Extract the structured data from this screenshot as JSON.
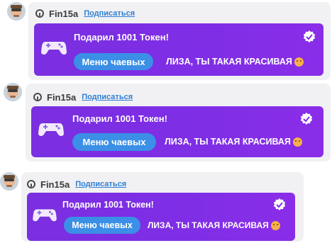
{
  "messages": [
    {
      "username": "Fin15a",
      "subscribe_label": "Подписаться",
      "title": "Подарил 1001 Токен!",
      "tip_button": "Меню чаевых",
      "text": "ЛИЗА, ТЫ ТАКАЯ КРАСИВАЯ"
    },
    {
      "username": "Fin15a",
      "subscribe_label": "Подписаться",
      "title": "Подарил 1001 Токен!",
      "tip_button": "Меню чаевых",
      "text": "ЛИЗА, ТЫ ТАКАЯ КРАСИВАЯ"
    },
    {
      "username": "Fin15a",
      "subscribe_label": "Подписаться",
      "title": "Подарил 1001 Токен!",
      "tip_button": "Меню чаевых",
      "text": "ЛИЗА, ТЫ ТАКАЯ КРАСИВАЯ"
    }
  ],
  "colors": {
    "card_gradient_start": "#7a2fe0",
    "card_gradient_end": "#8a2de8",
    "tip_button_bg": "#3b8fe6",
    "subscribe_link": "#2f7fd4",
    "panel_bg": "#f1f1f4"
  },
  "icons": {
    "avatar": "avatar",
    "user_badge": "ring-icon",
    "gift": "gamepad-icon",
    "verified": "verified-badge-icon",
    "emoji": "emoji-icon"
  }
}
